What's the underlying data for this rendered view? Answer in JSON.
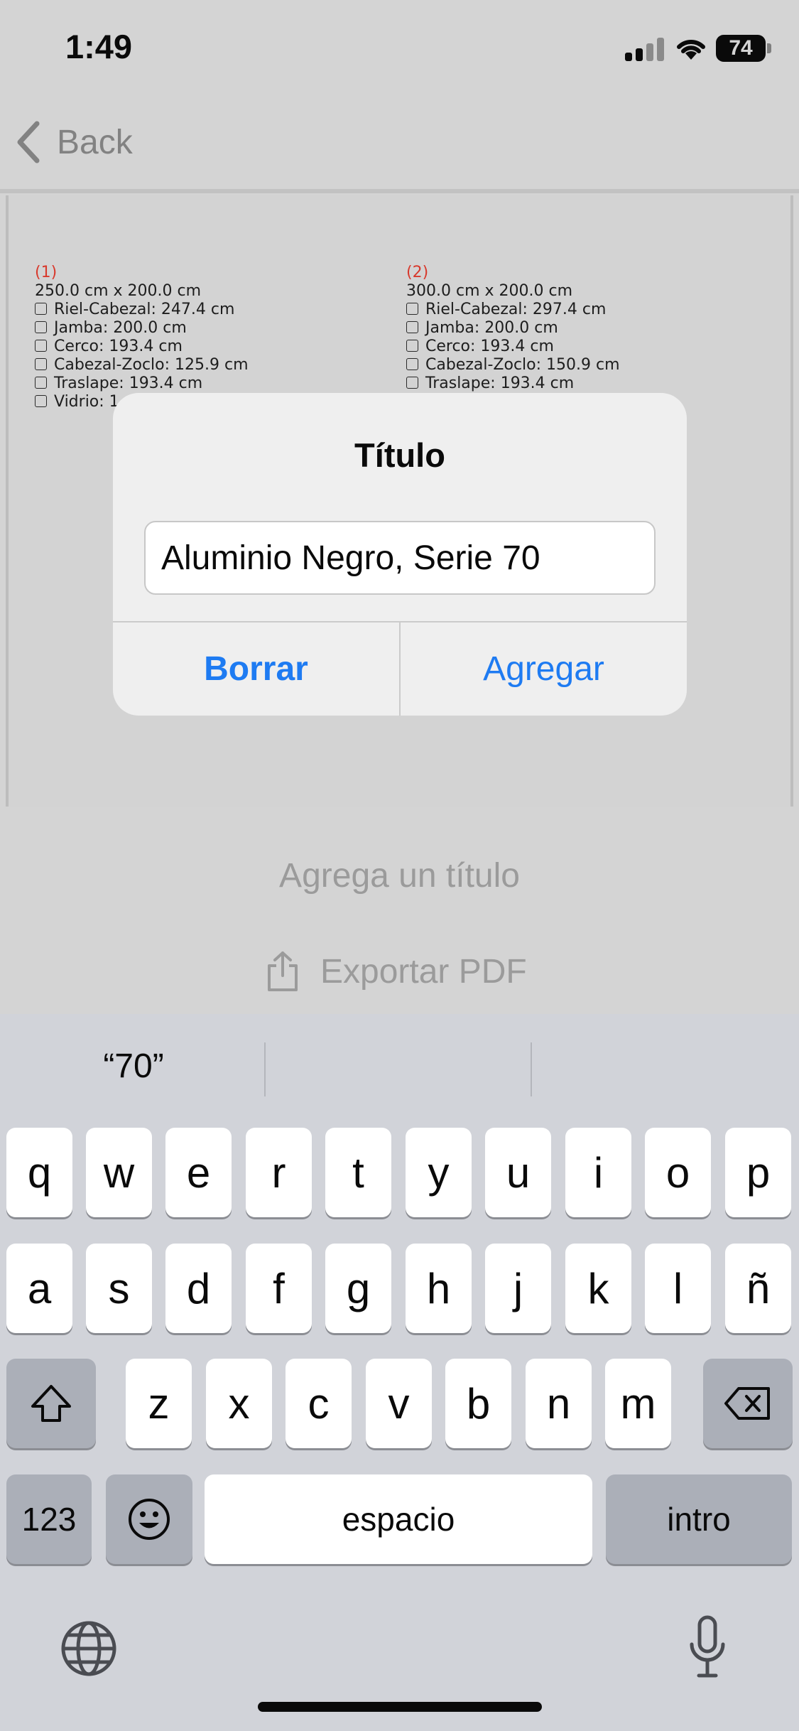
{
  "status_bar": {
    "time": "1:49",
    "battery": "74"
  },
  "nav": {
    "back_label": "Back"
  },
  "preview": {
    "items": [
      {
        "number": "(1)",
        "size": "250.0 cm x 200.0 cm",
        "parts": [
          "Riel-Cabezal: 247.4 cm",
          "Jamba: 200.0 cm",
          "Cerco: 193.4 cm",
          "Cabezal-Zoclo: 125.9 cm",
          "Traslape: 193.4 cm",
          "Vidrio: 1"
        ]
      },
      {
        "number": "(2)",
        "size": "300.0 cm x 200.0 cm",
        "parts": [
          "Riel-Cabezal: 297.4 cm",
          "Jamba: 200.0 cm",
          "Cerco: 193.4 cm",
          "Cabezal-Zoclo: 150.9 cm",
          "Traslape: 193.4 cm"
        ]
      }
    ]
  },
  "alert": {
    "title": "Título",
    "input_value": "Aluminio Negro, Serie 70",
    "delete_label": "Borrar",
    "add_label": "Agregar"
  },
  "below": {
    "add_title_label": "Agrega un título",
    "export_label": "Exportar PDF"
  },
  "keyboard": {
    "prediction": "“70”",
    "row1": [
      "q",
      "w",
      "e",
      "r",
      "t",
      "y",
      "u",
      "i",
      "o",
      "p"
    ],
    "row2": [
      "a",
      "s",
      "d",
      "f",
      "g",
      "h",
      "j",
      "k",
      "l",
      "ñ"
    ],
    "row3": [
      "z",
      "x",
      "c",
      "v",
      "b",
      "n",
      "m"
    ],
    "numbers_label": "123",
    "space_label": "espacio",
    "return_label": "intro"
  },
  "colors": {
    "accent": "#1e7bf2",
    "number_red": "#d8392c"
  }
}
